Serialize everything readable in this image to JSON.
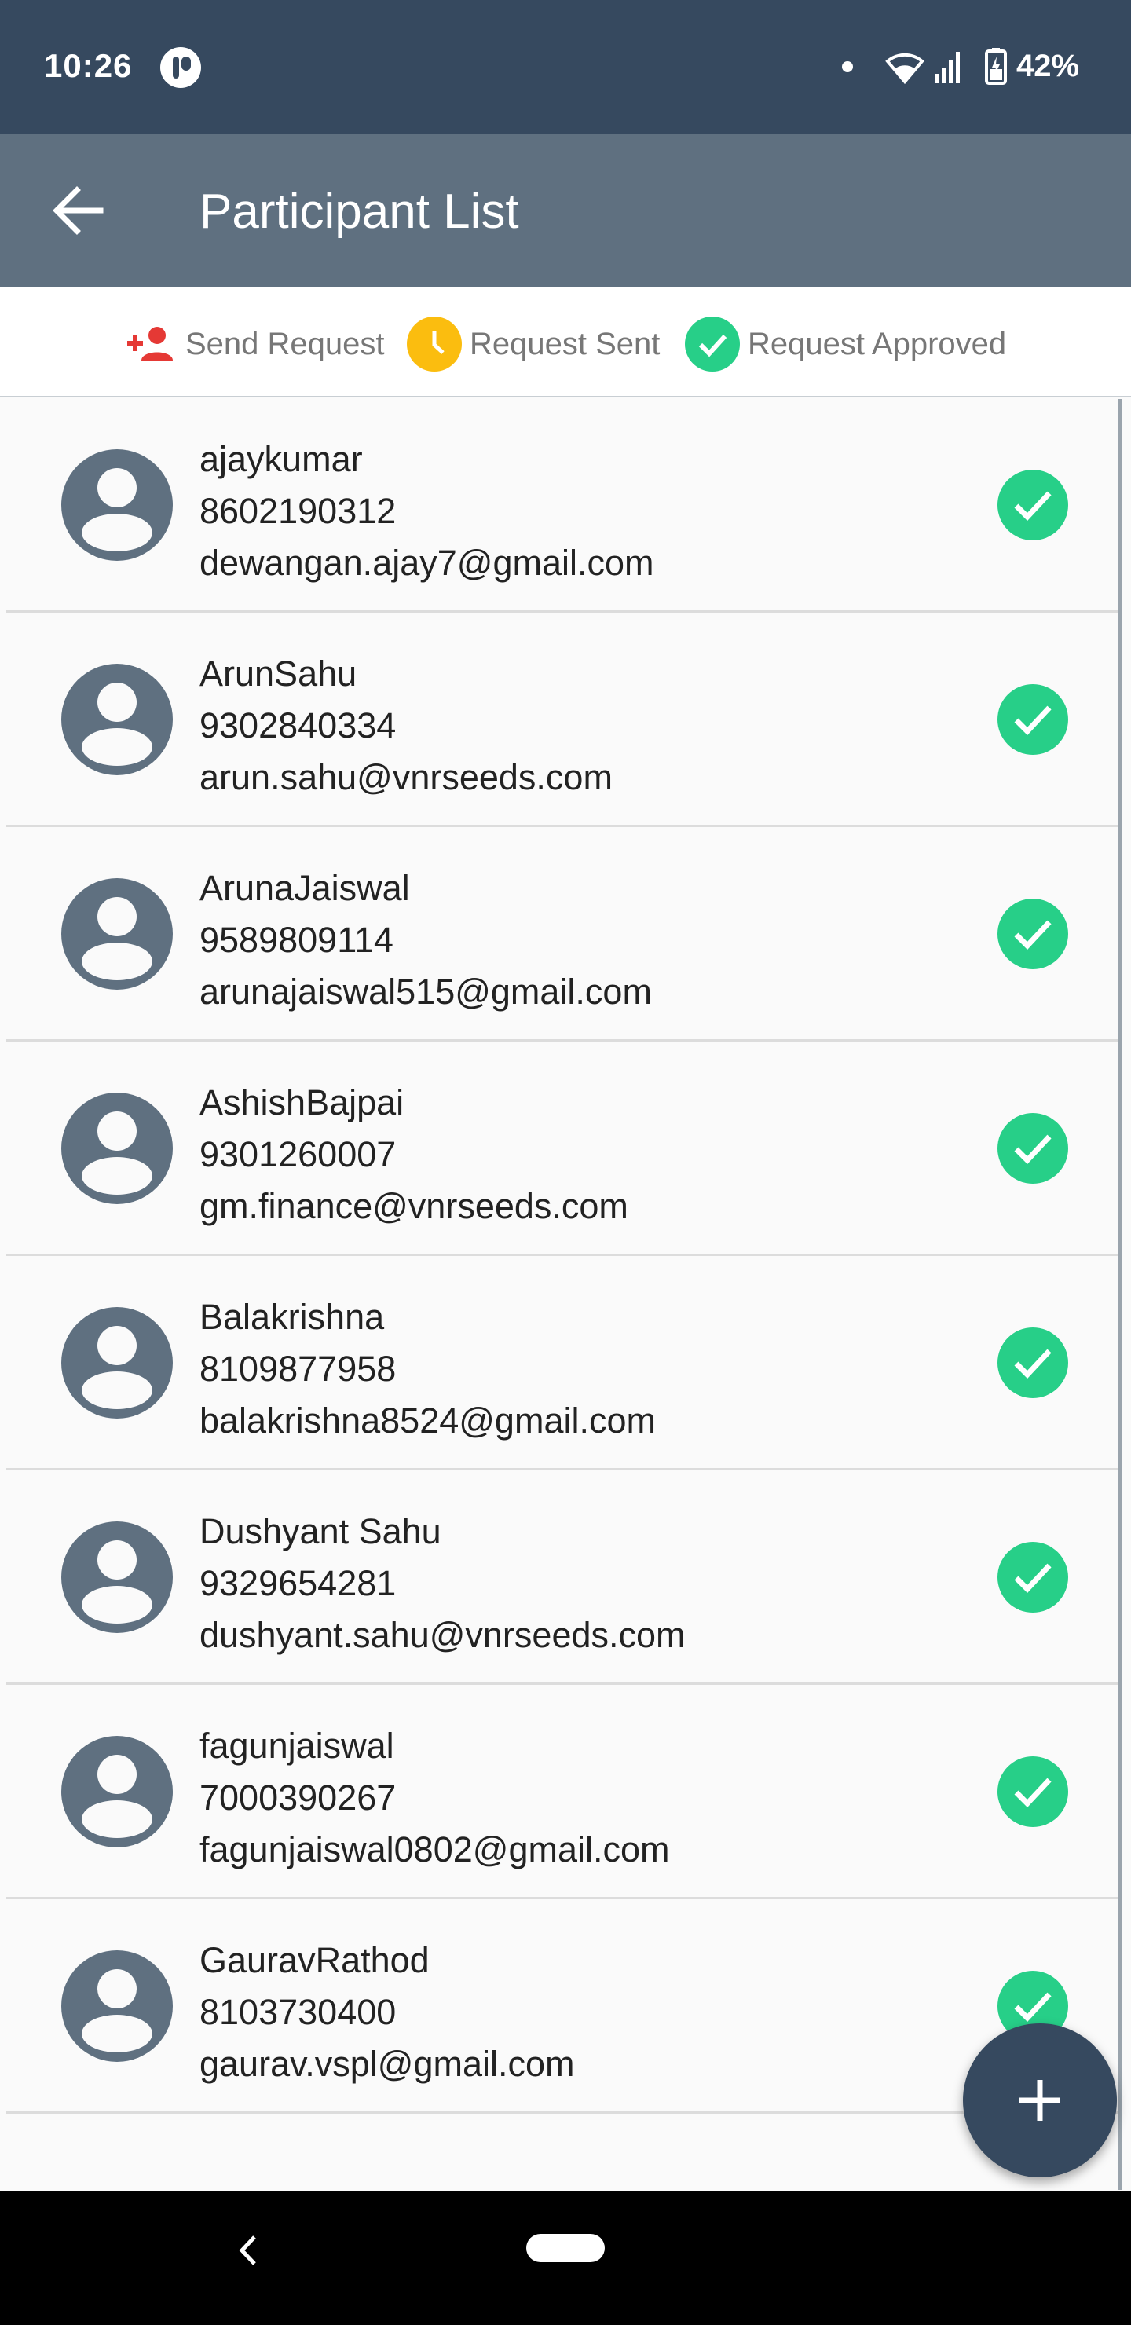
{
  "status_bar": {
    "time": "10:26",
    "battery_percent": "42%",
    "icons": [
      "app-icon",
      "dot-icon",
      "wifi-icon",
      "signal-icon",
      "battery-icon"
    ]
  },
  "app_bar": {
    "title": "Participant List",
    "back_icon": "arrow-left-icon"
  },
  "legend": {
    "send_request": "Send Request",
    "request_sent": "Request Sent",
    "request_approved": "Request Approved",
    "colors": {
      "send": "#e53935",
      "sent": "#fbbd0f",
      "approved": "#27cf88"
    }
  },
  "participants": [
    {
      "name": "ajaykumar",
      "phone": "8602190312",
      "email": "dewangan.ajay7@gmail.com",
      "status": "approved"
    },
    {
      "name": "ArunSahu",
      "phone": "9302840334",
      "email": "arun.sahu@vnrseeds.com",
      "status": "approved"
    },
    {
      "name": "ArunaJaiswal",
      "phone": "9589809114",
      "email": "arunajaiswal515@gmail.com",
      "status": "approved"
    },
    {
      "name": "AshishBajpai",
      "phone": "9301260007",
      "email": "gm.finance@vnrseeds.com",
      "status": "approved"
    },
    {
      "name": "Balakrishna",
      "phone": "8109877958",
      "email": "balakrishna8524@gmail.com",
      "status": "approved"
    },
    {
      "name": "Dushyant Sahu",
      "phone": "9329654281",
      "email": "dushyant.sahu@vnrseeds.com",
      "status": "approved"
    },
    {
      "name": "fagunjaiswal",
      "phone": "7000390267",
      "email": "fagunjaiswal0802@gmail.com",
      "status": "approved"
    },
    {
      "name": "GauravRathod",
      "phone": "8103730400",
      "email": "gaurav.vspl@gmail.com",
      "status": "approved"
    }
  ],
  "fab": {
    "icon": "plus-icon"
  },
  "nav_bar": {
    "icons": [
      "nav-back-icon",
      "nav-home-pill"
    ]
  }
}
